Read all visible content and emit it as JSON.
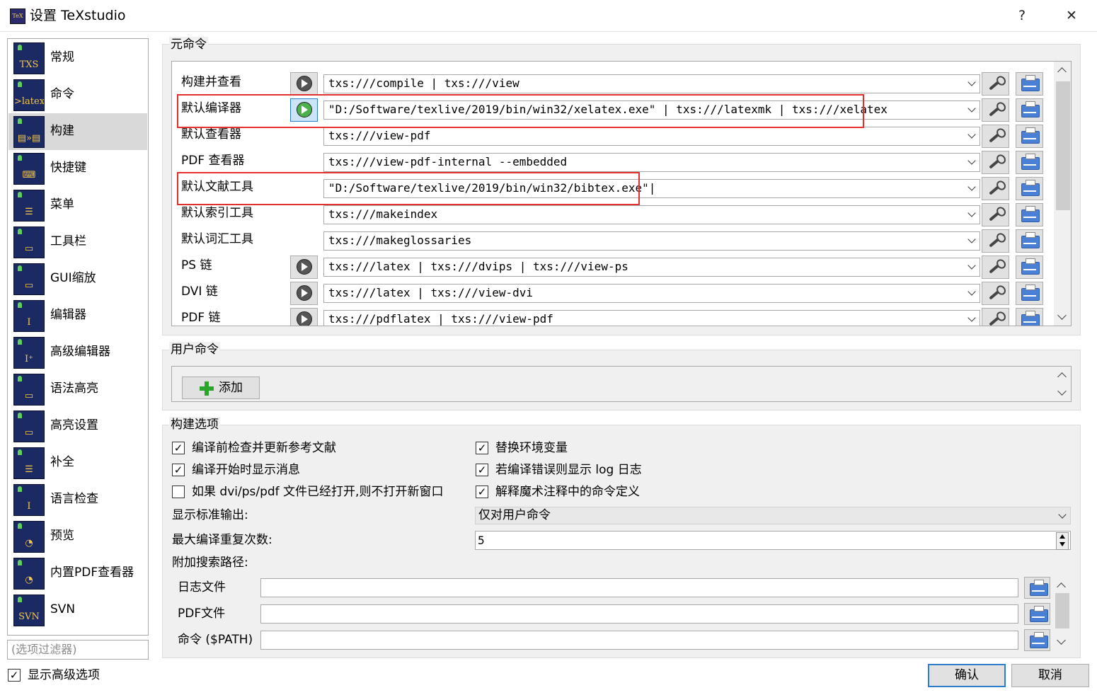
{
  "window": {
    "title": "设置 TeXstudio",
    "help_button": "?",
    "close_button": "✕"
  },
  "sidebar": {
    "items": [
      {
        "label": "常规",
        "icon_text": "TXS",
        "icon": "txs-icon"
      },
      {
        "label": "命令",
        "icon_text": ">latex",
        "icon": "latex-icon"
      },
      {
        "label": "构建",
        "icon_text": "▤»▤",
        "icon": "build-icon",
        "selected": true
      },
      {
        "label": "快捷键",
        "icon_text": "⌨",
        "icon": "keyboard-icon"
      },
      {
        "label": "菜单",
        "icon_text": "☰",
        "icon": "menu-icon"
      },
      {
        "label": "工具栏",
        "icon_text": "▭",
        "icon": "toolbar-icon"
      },
      {
        "label": "GUI缩放",
        "icon_text": "▭",
        "icon": "gui-scale-icon"
      },
      {
        "label": "编辑器",
        "icon_text": "I",
        "icon": "editor-icon"
      },
      {
        "label": "高级编辑器",
        "icon_text": "I⁺",
        "icon": "advanced-editor-icon"
      },
      {
        "label": "语法高亮",
        "icon_text": "▭",
        "icon": "syntax-highlight-icon"
      },
      {
        "label": "高亮设置",
        "icon_text": "▭",
        "icon": "highlight-settings-icon"
      },
      {
        "label": "补全",
        "icon_text": "☰",
        "icon": "completion-icon"
      },
      {
        "label": "语言检查",
        "icon_text": "I",
        "icon": "language-check-icon"
      },
      {
        "label": "预览",
        "icon_text": "◔",
        "icon": "preview-icon"
      },
      {
        "label": "内置PDF查看器",
        "icon_text": "◔",
        "icon": "pdf-viewer-icon"
      },
      {
        "label": "SVN",
        "icon_text": "SVN",
        "icon": "svn-icon"
      }
    ],
    "filter_placeholder": "(选项过滤器)",
    "show_advanced_label": "显示高级选项",
    "show_advanced_checked": true
  },
  "meta_commands": {
    "group_title": "元命令",
    "rows": [
      {
        "label": "构建并查看",
        "has_run": true,
        "value": "txs:///compile | txs:///view"
      },
      {
        "label": "默认编译器",
        "has_run": true,
        "active": true,
        "value": "\"D:/Software/texlive/2019/bin/win32/xelatex.exe\" | txs:///latexmk | txs:///xelatex"
      },
      {
        "label": "默认查看器",
        "has_run": false,
        "value": "txs:///view-pdf"
      },
      {
        "label": "PDF 查看器",
        "has_run": false,
        "value": "txs:///view-pdf-internal --embedded"
      },
      {
        "label": "默认文献工具",
        "has_run": false,
        "value": "\"D:/Software/texlive/2019/bin/win32/bibtex.exe\"|"
      },
      {
        "label": "默认索引工具",
        "has_run": false,
        "value": "txs:///makeindex"
      },
      {
        "label": "默认词汇工具",
        "has_run": false,
        "value": "txs:///makeglossaries"
      },
      {
        "label": "PS 链",
        "has_run": true,
        "value": "txs:///latex | txs:///dvips | txs:///view-ps"
      },
      {
        "label": "DVI 链",
        "has_run": true,
        "value": "txs:///latex | txs:///view-dvi"
      },
      {
        "label": "PDF 链",
        "has_run": true,
        "value": "txs:///pdflatex | txs:///view-pdf"
      }
    ]
  },
  "user_commands": {
    "group_title": "用户命令",
    "add_label": "添加"
  },
  "build_options": {
    "group_title": "构建选项",
    "checkboxes_left": [
      {
        "label": "编译前检查并更新参考文献",
        "checked": true
      },
      {
        "label": "编译开始时显示消息",
        "checked": true
      },
      {
        "label": "如果 dvi/ps/pdf 文件已经打开,则不打开新窗口",
        "checked": false
      }
    ],
    "checkboxes_right": [
      {
        "label": "替换环境变量",
        "checked": true
      },
      {
        "label": "若编译错误则显示 log 日志",
        "checked": true
      },
      {
        "label": "解释魔术注释中的命令定义",
        "checked": true
      }
    ],
    "stdout_label": "显示标准输出:",
    "stdout_value": "仅对用户命令",
    "max_repeat_label": "最大编译重复次数:",
    "max_repeat_value": "5",
    "search_paths_label": "附加搜索路径:",
    "paths": [
      {
        "label": "日志文件",
        "value": ""
      },
      {
        "label": "PDF文件",
        "value": ""
      },
      {
        "label": "命令 ($PATH)",
        "value": ""
      }
    ]
  },
  "footer": {
    "ok_label": "确认",
    "cancel_label": "取消"
  },
  "colors": {
    "highlight_red": "#e03030",
    "selected_nav": "#d9d9d9",
    "accent_blue": "#2c7dcf"
  }
}
